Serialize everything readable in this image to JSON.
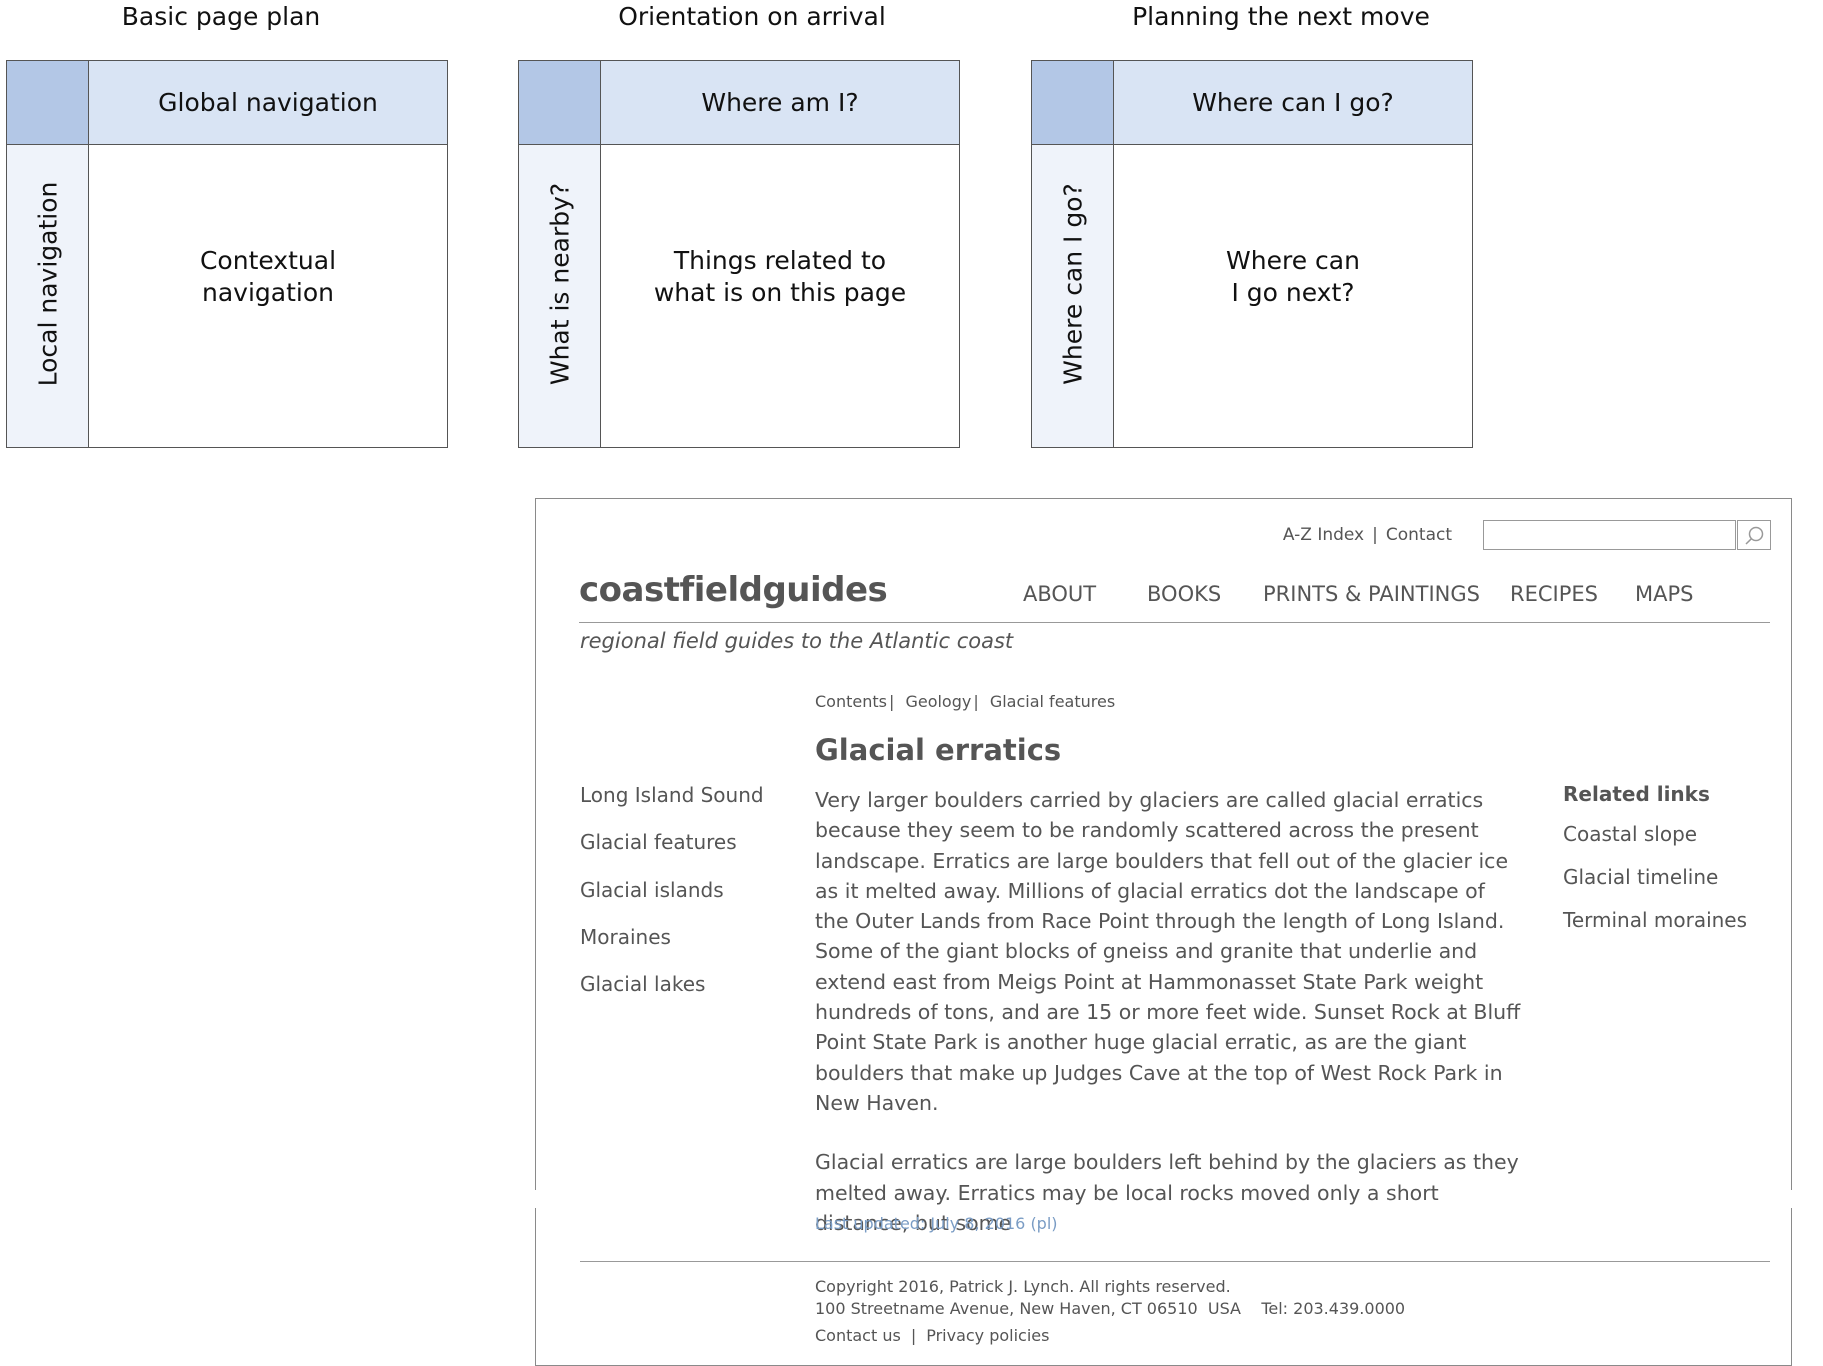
{
  "diagrams": [
    {
      "title": "Basic page plan",
      "top": "Global navigation",
      "side": "Local navigation",
      "center": "Contextual\nnavigation"
    },
    {
      "title": "Orientation on arrival",
      "top": "Where am I?",
      "side": "What is nearby?",
      "center": "Things related to\nwhat is on this page"
    },
    {
      "title": "Planning the next move",
      "top": "Where can I go?",
      "side": "Where can I go?",
      "center": "Where can\nI go next?"
    }
  ],
  "wireframe": {
    "utility": {
      "a_z": "A-Z Index",
      "sep": "|",
      "contact": "Contact"
    },
    "logo": "coastfieldguides",
    "tagline": "regional field guides to the Atlantic coast",
    "main_nav": [
      "ABOUT",
      "BOOKS",
      "PRINTS & PAINTINGS",
      "RECIPES",
      "MAPS"
    ],
    "breadcrumb": [
      "Contents",
      "Geology",
      "Glacial features"
    ],
    "breadcrumb_sep": "|",
    "title": "Glacial erratics",
    "local_nav": [
      "Long Island Sound",
      "Glacial features",
      "Glacial islands",
      "Moraines",
      "Glacial lakes"
    ],
    "body": [
      "Very larger boulders carried by glaciers are called glacial erratics because they seem to be randomly scattered across the present landscape. Erratics are large boulders that fell out of the glacier ice as it melted away. Millions of glacial erratics dot the landscape of the Outer Lands from Race Point through the length of Long Island. Some of the giant blocks of gneiss and granite that underlie and extend east from Meigs Point at Hammonasset State Park weight hundreds of tons, and are 15 or more feet wide. Sunset Rock at Bluff Point State Park is another huge glacial erratic, as are the giant boulders that make up Judges Cave at the top of West Rock Park in New Haven.",
      "Glacial erratics are large boulders left behind by the glaciers as they melted away. Erratics may be local rocks moved only a short distance, but some"
    ],
    "related": {
      "heading": "Related links",
      "items": [
        "Coastal slope",
        "Glacial timeline",
        "Terminal moraines"
      ]
    },
    "updated": "Last updated: July 8, 2016 (pl)",
    "copyright": "Copyright 2016, Patrick J. Lynch. All rights reserved.",
    "address": "100 Streetname Avenue, New Haven, CT 06510  USA    Tel: 203.439.0000",
    "footer_links": {
      "contact": "Contact us",
      "sep": "|",
      "privacy": "Privacy policies"
    }
  }
}
